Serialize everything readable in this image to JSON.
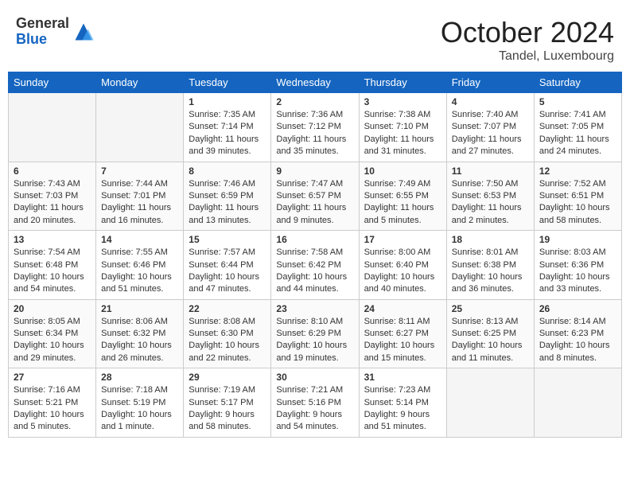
{
  "header": {
    "logo_general": "General",
    "logo_blue": "Blue",
    "month_title": "October 2024",
    "location": "Tandel, Luxembourg"
  },
  "weekdays": [
    "Sunday",
    "Monday",
    "Tuesday",
    "Wednesday",
    "Thursday",
    "Friday",
    "Saturday"
  ],
  "weeks": [
    [
      {
        "day": "",
        "info": ""
      },
      {
        "day": "",
        "info": ""
      },
      {
        "day": "1",
        "info": "Sunrise: 7:35 AM\nSunset: 7:14 PM\nDaylight: 11 hours and 39 minutes."
      },
      {
        "day": "2",
        "info": "Sunrise: 7:36 AM\nSunset: 7:12 PM\nDaylight: 11 hours and 35 minutes."
      },
      {
        "day": "3",
        "info": "Sunrise: 7:38 AM\nSunset: 7:10 PM\nDaylight: 11 hours and 31 minutes."
      },
      {
        "day": "4",
        "info": "Sunrise: 7:40 AM\nSunset: 7:07 PM\nDaylight: 11 hours and 27 minutes."
      },
      {
        "day": "5",
        "info": "Sunrise: 7:41 AM\nSunset: 7:05 PM\nDaylight: 11 hours and 24 minutes."
      }
    ],
    [
      {
        "day": "6",
        "info": "Sunrise: 7:43 AM\nSunset: 7:03 PM\nDaylight: 11 hours and 20 minutes."
      },
      {
        "day": "7",
        "info": "Sunrise: 7:44 AM\nSunset: 7:01 PM\nDaylight: 11 hours and 16 minutes."
      },
      {
        "day": "8",
        "info": "Sunrise: 7:46 AM\nSunset: 6:59 PM\nDaylight: 11 hours and 13 minutes."
      },
      {
        "day": "9",
        "info": "Sunrise: 7:47 AM\nSunset: 6:57 PM\nDaylight: 11 hours and 9 minutes."
      },
      {
        "day": "10",
        "info": "Sunrise: 7:49 AM\nSunset: 6:55 PM\nDaylight: 11 hours and 5 minutes."
      },
      {
        "day": "11",
        "info": "Sunrise: 7:50 AM\nSunset: 6:53 PM\nDaylight: 11 hours and 2 minutes."
      },
      {
        "day": "12",
        "info": "Sunrise: 7:52 AM\nSunset: 6:51 PM\nDaylight: 10 hours and 58 minutes."
      }
    ],
    [
      {
        "day": "13",
        "info": "Sunrise: 7:54 AM\nSunset: 6:48 PM\nDaylight: 10 hours and 54 minutes."
      },
      {
        "day": "14",
        "info": "Sunrise: 7:55 AM\nSunset: 6:46 PM\nDaylight: 10 hours and 51 minutes."
      },
      {
        "day": "15",
        "info": "Sunrise: 7:57 AM\nSunset: 6:44 PM\nDaylight: 10 hours and 47 minutes."
      },
      {
        "day": "16",
        "info": "Sunrise: 7:58 AM\nSunset: 6:42 PM\nDaylight: 10 hours and 44 minutes."
      },
      {
        "day": "17",
        "info": "Sunrise: 8:00 AM\nSunset: 6:40 PM\nDaylight: 10 hours and 40 minutes."
      },
      {
        "day": "18",
        "info": "Sunrise: 8:01 AM\nSunset: 6:38 PM\nDaylight: 10 hours and 36 minutes."
      },
      {
        "day": "19",
        "info": "Sunrise: 8:03 AM\nSunset: 6:36 PM\nDaylight: 10 hours and 33 minutes."
      }
    ],
    [
      {
        "day": "20",
        "info": "Sunrise: 8:05 AM\nSunset: 6:34 PM\nDaylight: 10 hours and 29 minutes."
      },
      {
        "day": "21",
        "info": "Sunrise: 8:06 AM\nSunset: 6:32 PM\nDaylight: 10 hours and 26 minutes."
      },
      {
        "day": "22",
        "info": "Sunrise: 8:08 AM\nSunset: 6:30 PM\nDaylight: 10 hours and 22 minutes."
      },
      {
        "day": "23",
        "info": "Sunrise: 8:10 AM\nSunset: 6:29 PM\nDaylight: 10 hours and 19 minutes."
      },
      {
        "day": "24",
        "info": "Sunrise: 8:11 AM\nSunset: 6:27 PM\nDaylight: 10 hours and 15 minutes."
      },
      {
        "day": "25",
        "info": "Sunrise: 8:13 AM\nSunset: 6:25 PM\nDaylight: 10 hours and 11 minutes."
      },
      {
        "day": "26",
        "info": "Sunrise: 8:14 AM\nSunset: 6:23 PM\nDaylight: 10 hours and 8 minutes."
      }
    ],
    [
      {
        "day": "27",
        "info": "Sunrise: 7:16 AM\nSunset: 5:21 PM\nDaylight: 10 hours and 5 minutes."
      },
      {
        "day": "28",
        "info": "Sunrise: 7:18 AM\nSunset: 5:19 PM\nDaylight: 10 hours and 1 minute."
      },
      {
        "day": "29",
        "info": "Sunrise: 7:19 AM\nSunset: 5:17 PM\nDaylight: 9 hours and 58 minutes."
      },
      {
        "day": "30",
        "info": "Sunrise: 7:21 AM\nSunset: 5:16 PM\nDaylight: 9 hours and 54 minutes."
      },
      {
        "day": "31",
        "info": "Sunrise: 7:23 AM\nSunset: 5:14 PM\nDaylight: 9 hours and 51 minutes."
      },
      {
        "day": "",
        "info": ""
      },
      {
        "day": "",
        "info": ""
      }
    ]
  ]
}
